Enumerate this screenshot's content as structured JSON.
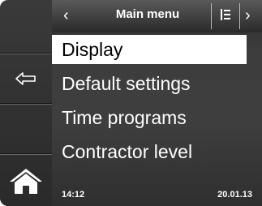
{
  "header": {
    "title": "Main menu",
    "back_glyph": "‹",
    "forward_glyph": "›",
    "list_icon": "list-icon"
  },
  "sidebar": {
    "buttons": [
      {
        "icon": "none"
      },
      {
        "icon": "back-arrow-icon"
      },
      {
        "icon": "none"
      },
      {
        "icon": "home-icon"
      }
    ]
  },
  "menu": {
    "items": [
      {
        "label": "Display",
        "selected": true
      },
      {
        "label": "Default settings",
        "selected": false
      },
      {
        "label": "Time programs",
        "selected": false
      },
      {
        "label": "Contractor level",
        "selected": false
      }
    ]
  },
  "status": {
    "time": "14:12",
    "date": "20.01.13"
  },
  "colors": {
    "selected_bg": "#ffffff",
    "text": "#ffffff",
    "background": "#3d3d3d"
  }
}
